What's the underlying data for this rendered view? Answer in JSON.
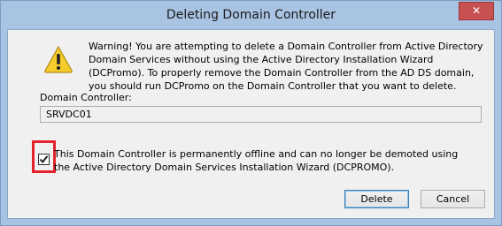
{
  "window": {
    "title": "Deleting Domain Controller",
    "close_label": "✕"
  },
  "dialog": {
    "icon": "warning-icon",
    "warning_text": "Warning! You are attempting to delete a Domain Controller from Active Directory Domain Services without using the Active Directory Installation Wizard (DCPromo). To properly remove the Domain Controller from the AD DS domain, you should run DCPromo on the Domain Controller that you want to delete.",
    "dc_label": "Domain Controller:",
    "dc_value": "SRVDC01",
    "offline_checkbox": {
      "checked": true,
      "label": "This Domain Controller is permanently offline and can no longer be demoted using the Active Directory Domain Services Installation Wizard (DCPROMO)."
    },
    "delete_label": "Delete",
    "cancel_label": "Cancel"
  },
  "colors": {
    "titlebar": "#a9c3e3",
    "close_button": "#c75050",
    "highlight": "#e3222b",
    "warning_yellow": "#f5cc2c"
  }
}
